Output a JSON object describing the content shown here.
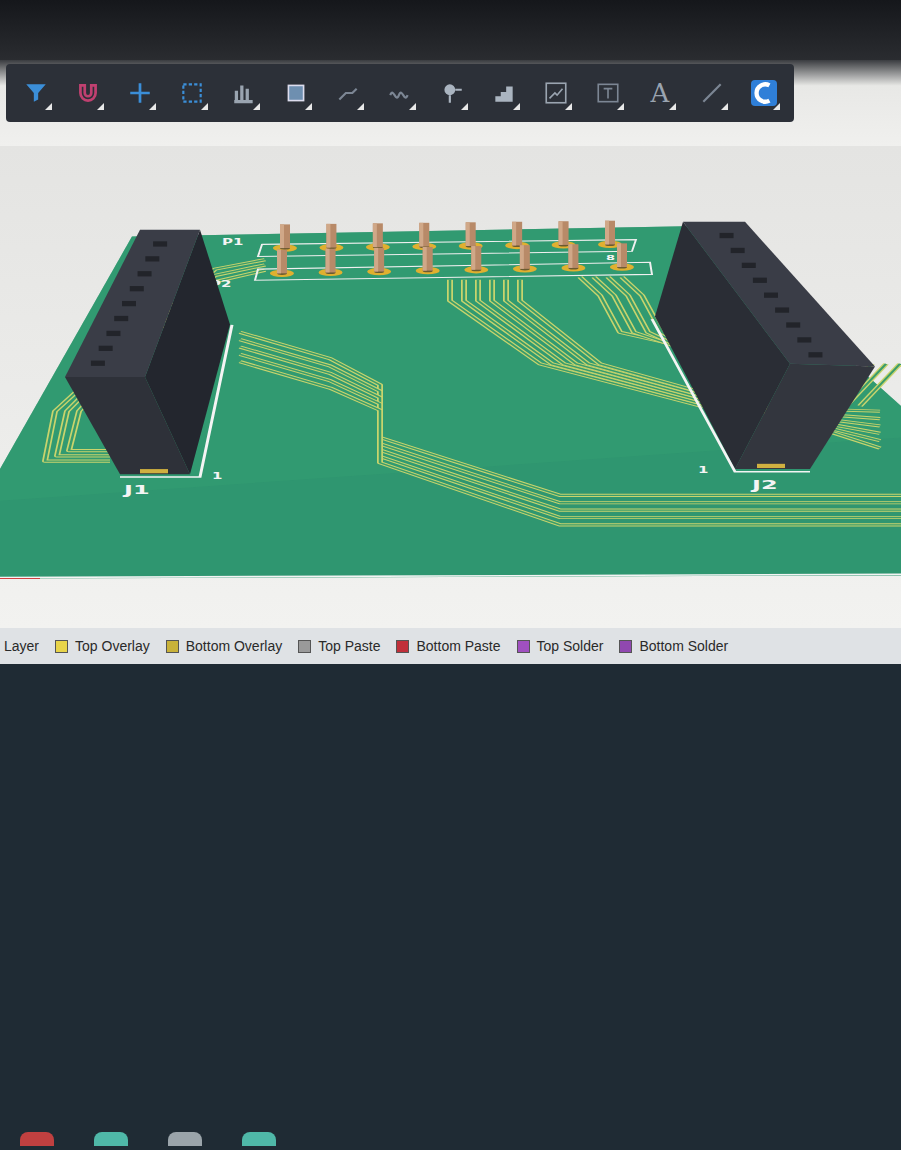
{
  "toolbar": {
    "items": [
      {
        "kind": "icon",
        "selected": false
      },
      {
        "kind": "icon",
        "selected": false
      },
      {
        "kind": "icon",
        "selected": false
      },
      {
        "kind": "icon",
        "selected": false
      },
      {
        "kind": "icon",
        "selected": false
      },
      {
        "kind": "icon",
        "selected": false
      },
      {
        "kind": "icon",
        "selected": false
      },
      {
        "kind": "icon",
        "selected": false
      },
      {
        "kind": "icon",
        "selected": false
      },
      {
        "kind": "icon",
        "selected": false
      },
      {
        "kind": "icon",
        "selected": false
      },
      {
        "kind": "icon",
        "selected": false
      },
      {
        "kind": "text",
        "label": "A",
        "selected": false
      },
      {
        "kind": "icon",
        "selected": false
      },
      {
        "kind": "icon",
        "selected": true
      }
    ]
  },
  "board": {
    "headers": [
      {
        "label": "P1",
        "pins": 8,
        "end_label": "8"
      },
      {
        "label": "P2",
        "pins": 8,
        "end_label": ""
      }
    ],
    "connectors": [
      {
        "label": "J1",
        "pin1": "1",
        "holes": 9
      },
      {
        "label": "J2",
        "pin1": "1",
        "holes": 9
      }
    ]
  },
  "layers": [
    {
      "label": "Layer",
      "color": ""
    },
    {
      "label": "Top Overlay",
      "color": "#e8d44a"
    },
    {
      "label": "Bottom Overlay",
      "color": "#c9b23a"
    },
    {
      "label": "Top Paste",
      "color": "#9a9a9a"
    },
    {
      "label": "Bottom Paste",
      "color": "#c0303a"
    },
    {
      "label": "Top Solder",
      "color": "#a050c0"
    },
    {
      "label": "Bottom Solder",
      "color": "#9048b0"
    }
  ]
}
